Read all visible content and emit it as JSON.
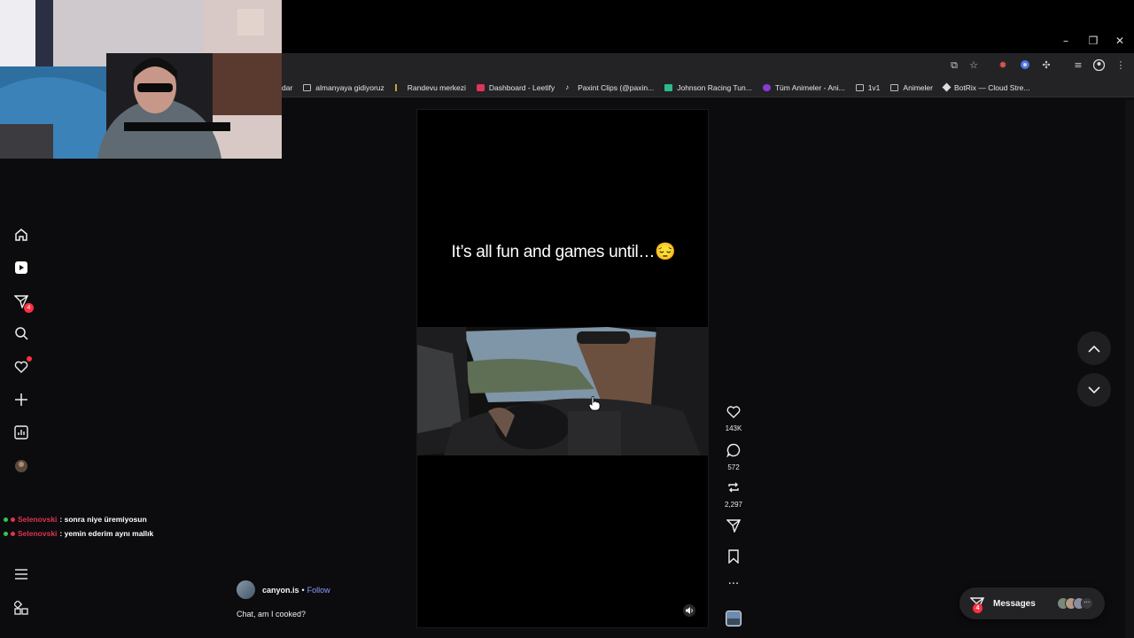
{
  "browser": {
    "bookmarks": [
      {
        "label": "dar",
        "icon": "none"
      },
      {
        "label": "almanyaya gidiyoruz",
        "icon": "folder"
      },
      {
        "label": "Randevu merkezi",
        "icon": "site"
      },
      {
        "label": "Dashboard - Leetify",
        "icon": "site"
      },
      {
        "label": "Paxint Clips (@paxin...",
        "icon": "tiktok"
      },
      {
        "label": "Johnson Racing Tun...",
        "icon": "site"
      },
      {
        "label": "Tüm Animeler - Ani...",
        "icon": "site"
      },
      {
        "label": "1v1",
        "icon": "folder"
      },
      {
        "label": "Animeler",
        "icon": "folder"
      },
      {
        "label": "BotRix — Cloud Stre...",
        "icon": "site"
      }
    ],
    "window_controls": {
      "minimize": "–",
      "restore": "❐",
      "close": "✕"
    }
  },
  "sidebar": {
    "notifications_badge": "4"
  },
  "chat": [
    {
      "user": "Selenovski",
      "message": ": sonra niye üremiyosun"
    },
    {
      "user": "Selenovski",
      "message": ": yemin ederim aynı mallık"
    }
  ],
  "reel": {
    "overlay_text": "It’s all fun and games until…😔",
    "author": "canyon.is",
    "separator": "•",
    "follow_label": "Follow",
    "caption": "Chat, am I cooked?"
  },
  "actions": {
    "likes": "143K",
    "comments": "572",
    "reposts": "2,297"
  },
  "messages": {
    "label": "Messages",
    "badge": "4"
  },
  "colors": {
    "accent_red": "#ff3040",
    "follow_blue": "#8c9cff",
    "chat_user": "#e0344d"
  }
}
